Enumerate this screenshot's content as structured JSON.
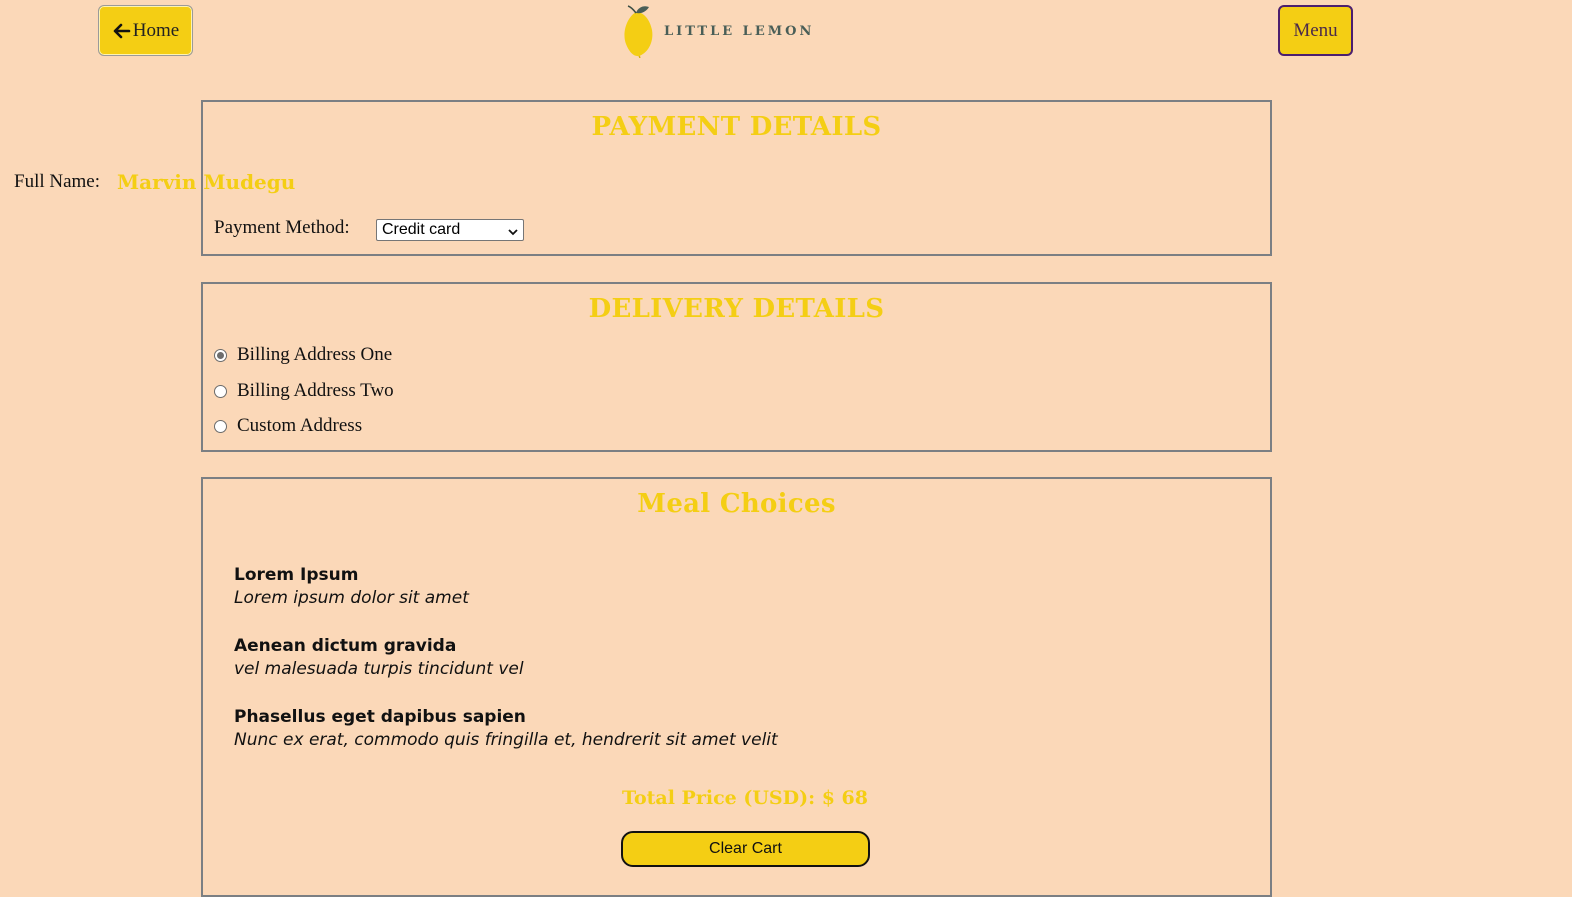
{
  "header": {
    "home_label": "Home",
    "menu_label": "Menu",
    "logo_text": "LITTLE LEMON"
  },
  "payment": {
    "title": "PAYMENT DETAILS",
    "full_name_label": "Full Name:",
    "full_name_value": "Marvin Mudegu",
    "method_label": "Payment Method:",
    "method_selected": "Credit card"
  },
  "delivery": {
    "title": "DELIVERY DETAILS",
    "options": [
      {
        "label": "Billing Address One",
        "checked": true
      },
      {
        "label": "Billing Address Two",
        "checked": false
      },
      {
        "label": "Custom Address",
        "checked": false
      }
    ]
  },
  "meals": {
    "title": "Meal Choices",
    "items": [
      {
        "name": "Lorem Ipsum",
        "description": "Lorem ipsum dolor sit amet"
      },
      {
        "name": "Aenean dictum gravida",
        "description": "vel malesuada turpis tincidunt vel"
      },
      {
        "name": "Phasellus eget dapibus sapien",
        "description": "Nunc ex erat, commodo quis fringilla et, hendrerit sit amet velit"
      }
    ],
    "total_label": "Total Price (USD): $ 68",
    "clear_label": "Clear Cart"
  },
  "colors": {
    "background": "#fbd8b8",
    "accent": "#f4ce14",
    "brand_green": "#495e57"
  },
  "icons": {
    "home": "arrow-left-icon",
    "logo": "lemon-icon",
    "select": "chevron-down-icon"
  }
}
